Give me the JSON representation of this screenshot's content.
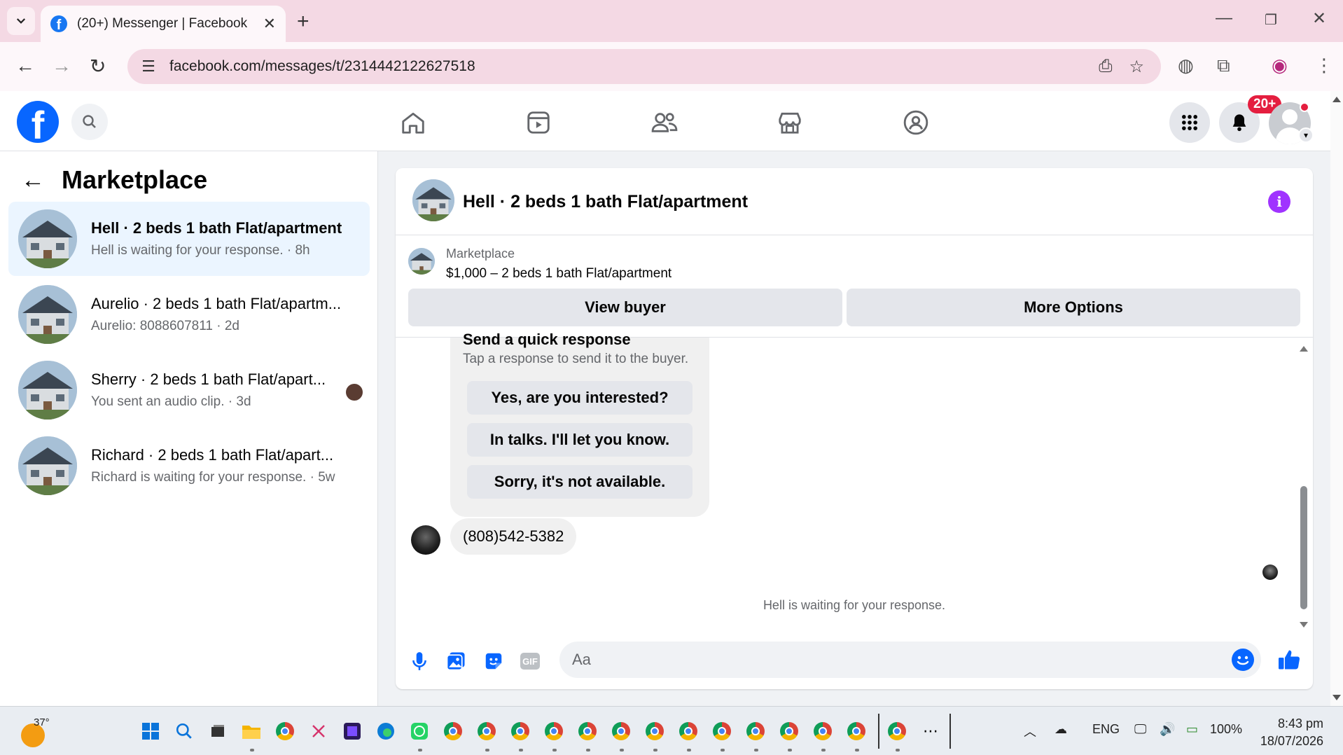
{
  "browser": {
    "tab_title": "(20+) Messenger | Facebook",
    "new_tab": "+",
    "url": "facebook.com/messages/t/2314442122627518"
  },
  "fb": {
    "notif_badge": "20+"
  },
  "left": {
    "title": "Marketplace",
    "conversations": [
      {
        "name": "Hell · 2 beds 1 bath Flat/apartment",
        "sub": "Hell is waiting for your response. · 8h"
      },
      {
        "name": "Aurelio · 2 beds 1 bath Flat/apartm...",
        "sub": "Aurelio: 8088607811 · 2d"
      },
      {
        "name": "Sherry · 2 beds 1 bath Flat/apart...",
        "sub": "You sent an audio clip. · 3d"
      },
      {
        "name": "Richard · 2 beds 1 bath Flat/apart...",
        "sub": "Richard is waiting for your response. · 5w"
      }
    ]
  },
  "chat": {
    "title": "Hell · 2 beds 1 bath Flat/apartment",
    "listing_label": "Marketplace",
    "listing_price": "$1,000 – 2 beds 1 bath Flat/apartment",
    "view_buyer": "View buyer",
    "more_options": "More Options",
    "quick_title": "Send a quick response",
    "quick_sub": "Tap a response to send it to the buyer.",
    "quick_responses": [
      "Yes, are you interested?",
      "In talks. I'll let you know.",
      "Sorry, it's not available."
    ],
    "message": "(808)542-5382",
    "waiting": "Hell is waiting for your response.",
    "composer_placeholder": "Aa"
  },
  "taskbar": {
    "temp": "37°",
    "lang": "ENG",
    "battery": "100%",
    "time": "8:43 pm",
    "date": "18/07/2026"
  },
  "colors": {
    "fb_blue": "#0866ff",
    "active_row": "#ebf5ff",
    "badge_red": "#e41e3f",
    "info_purple": "#a033ff"
  }
}
